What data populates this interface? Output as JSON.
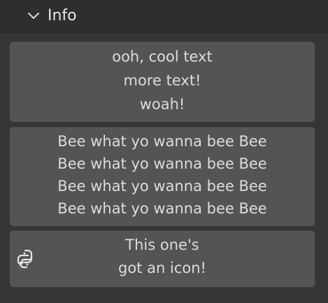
{
  "panel": {
    "title": "Info",
    "expand_icon": "chevron-down-icon"
  },
  "boxes": [
    {
      "lines": [
        "ooh, cool text",
        "more text!",
        "woah!"
      ]
    },
    {
      "lines": [
        "Bee what yo wanna bee Bee",
        "Bee what yo wanna bee Bee",
        "Bee what yo wanna bee Bee",
        "Bee what yo wanna bee Bee"
      ]
    },
    {
      "icon": "python-icon",
      "lines": [
        "This one's",
        "got an icon!"
      ]
    }
  ],
  "colors": {
    "background": "#353535",
    "header": "#2e2e2e",
    "box": "#545454",
    "text": "#dcdcdc"
  }
}
